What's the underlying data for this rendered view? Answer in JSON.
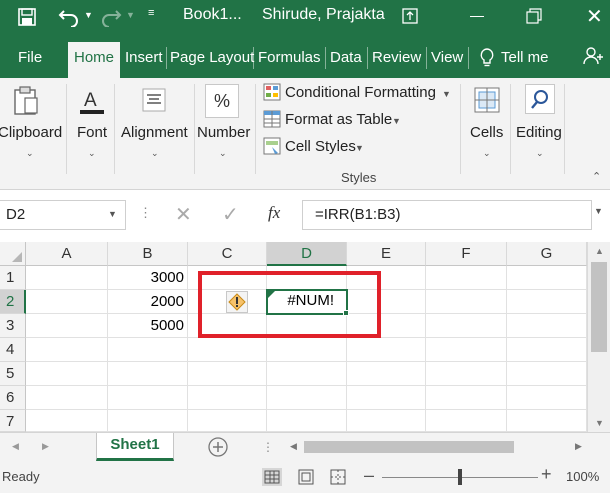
{
  "app": {
    "accent": "#217346",
    "highlight_color": "#e0212a",
    "window_title": "Book1...",
    "user_name": "Shirude, Prajakta"
  },
  "tabs": [
    {
      "label": "File"
    },
    {
      "label": "Home"
    },
    {
      "label": "Insert"
    },
    {
      "label": "Page Layout"
    },
    {
      "label": "Formulas"
    },
    {
      "label": "Data"
    },
    {
      "label": "Review"
    },
    {
      "label": "View"
    },
    {
      "label": "Tell me"
    }
  ],
  "ribbon": {
    "clipboard": "Clipboard",
    "font": "Font",
    "alignment": "Alignment",
    "number": "Number",
    "percent_glyph": "%",
    "conditional_formatting": "Conditional Formatting",
    "format_as_table": "Format as Table",
    "cell_styles": "Cell Styles",
    "styles_group": "Styles",
    "cells": "Cells",
    "editing": "Editing"
  },
  "formula_bar": {
    "name_box": "D2",
    "fx": "fx",
    "formula": "=IRR(B1:B3)"
  },
  "grid": {
    "columns": [
      "A",
      "B",
      "C",
      "D",
      "E",
      "F",
      "G"
    ],
    "rows": [
      "1",
      "2",
      "3",
      "4",
      "5",
      "6",
      "7"
    ],
    "values": {
      "B1": "3000",
      "B2": "2000",
      "B3": "5000",
      "D2": "#NUM!"
    },
    "active_cell": "D2"
  },
  "sheets": [
    {
      "label": "Sheet1",
      "active": true
    }
  ],
  "status": {
    "ready": "Ready",
    "zoom": "100%"
  }
}
